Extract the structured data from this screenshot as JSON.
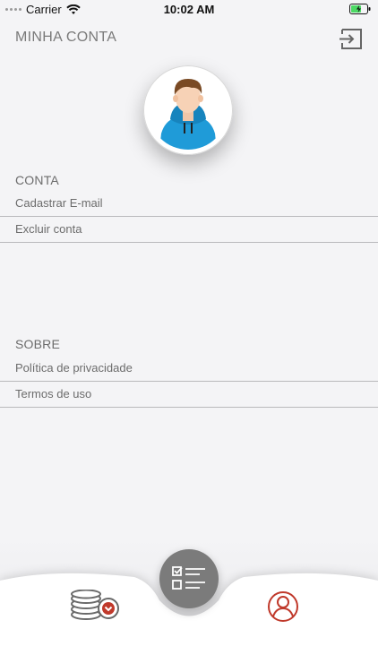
{
  "status": {
    "carrier": "Carrier",
    "time": "10:02 AM"
  },
  "header": {
    "title": "MINHA CONTA"
  },
  "sections": {
    "conta": {
      "label": "CONTA",
      "items": [
        {
          "label": "Cadastrar E-mail"
        },
        {
          "label": "Excluir conta"
        }
      ]
    },
    "sobre": {
      "label": "SOBRE",
      "items": [
        {
          "label": "Política de privacidade"
        },
        {
          "label": "Termos de uso"
        }
      ]
    }
  },
  "icons": {
    "logout": "logout-icon",
    "avatar": "avatar-illustration",
    "fab": "checklist-icon",
    "coins": "coins-icon",
    "profile": "user-profile-icon"
  },
  "colors": {
    "background": "#f4f4f6",
    "accent_red": "#c0392b",
    "fab_gray": "#7b7b7b",
    "hoodie_blue": "#1f9bd8",
    "hair_brown": "#7a4a24"
  }
}
